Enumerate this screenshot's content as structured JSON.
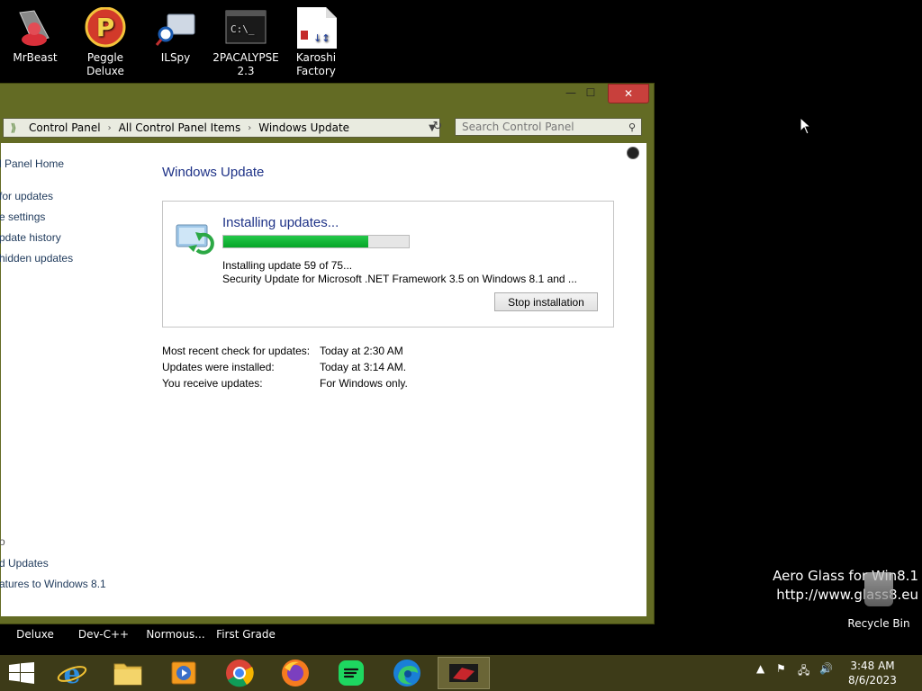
{
  "desktop": {
    "icons": [
      {
        "label": "MrBeast"
      },
      {
        "label": "Peggle Deluxe"
      },
      {
        "label": "ILSpy"
      },
      {
        "label": "2PACALYPSE 2.3"
      },
      {
        "label": "Karoshi Factory"
      }
    ],
    "recycle_bin": "Recycle Bin",
    "watermark_line1": "Aero Glass for Win8.1",
    "watermark_line2": "http://www.glass8.eu",
    "behind_labels": [
      "Deluxe",
      "Dev-C++",
      "Normous...",
      "First Grade"
    ]
  },
  "window": {
    "controls": {
      "minimize": "—",
      "maximize": "☐",
      "close": "✕"
    },
    "address": {
      "crumbs": [
        "Control Panel",
        "All Control Panel Items",
        "Windows Update"
      ]
    },
    "search_placeholder": "Search Control Panel",
    "left_nav": {
      "home": "l Panel Home",
      "links": [
        "for updates",
        "e settings",
        "pdate history",
        "hidden updates"
      ]
    },
    "see_also": {
      "heading": "o",
      "links": [
        "d Updates",
        "atures to Windows 8.1"
      ]
    },
    "heading": "Windows Update",
    "install": {
      "title": "Installing updates...",
      "progress": 0.78,
      "status": "Installing update 59 of 75...",
      "current": "Security Update for Microsoft .NET Framework 3.5 on Windows 8.1 and ...",
      "stop_button": "Stop installation"
    },
    "info": [
      {
        "key": "Most recent check for updates:",
        "value": "Today at 2:30 AM"
      },
      {
        "key": "Updates were installed:",
        "value": "Today at 3:14 AM."
      },
      {
        "key": "You receive updates:",
        "value": "For Windows only."
      }
    ]
  },
  "taskbar": {
    "apps": [
      "start-button",
      "internet-explorer-icon",
      "file-explorer-icon",
      "media-player-icon",
      "chrome-icon",
      "firefox-icon",
      "spotify-icon",
      "edge-icon",
      "game-window-icon"
    ],
    "clock_time": "3:48 AM",
    "clock_date": "8/6/2023"
  },
  "colors": {
    "window_frame": "#636b24",
    "taskbar": "#3d3b18",
    "link": "#1e395b",
    "heading": "#1e3287",
    "progress": "#06b02e",
    "close_button": "#c8403c"
  }
}
